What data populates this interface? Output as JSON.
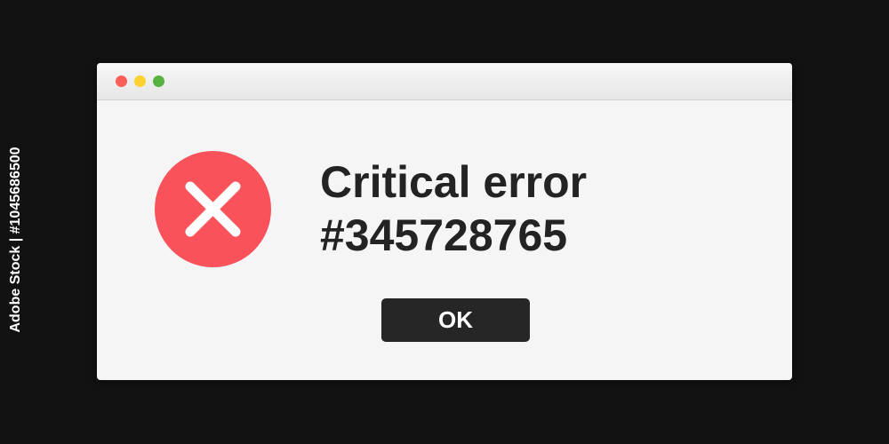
{
  "dialog": {
    "traffic_lights": {
      "close_color": "#ff5f57",
      "minimize_color": "#fbd22f",
      "zoom_color": "#56b33f"
    },
    "icon": {
      "name": "error-x-icon",
      "color": "#f9525b"
    },
    "message_line1": "Critical error",
    "message_line2": "#345728765",
    "ok_label": "OK"
  },
  "watermark": {
    "side_text": "Adobe Stock | #1045686500"
  },
  "colors": {
    "background": "#121212",
    "window": "#f5f5f5",
    "button": "#262626",
    "text": "#232323"
  }
}
